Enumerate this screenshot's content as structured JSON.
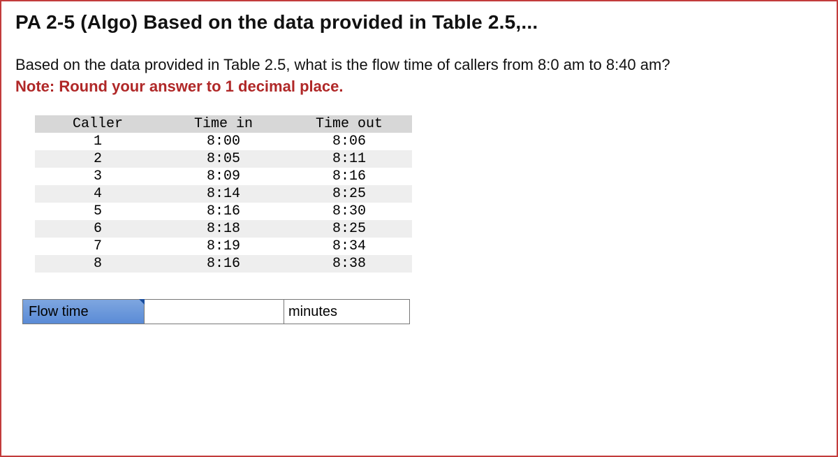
{
  "title": "PA 2-5 (Algo) Based on the data provided in Table 2.5,...",
  "question": "Based on the data provided in Table 2.5, what is the flow time of callers from 8:0 am to 8:40 am?",
  "note": "Note: Round your answer to 1 decimal place.",
  "table": {
    "headers": {
      "c1": "Caller",
      "c2": "Time in",
      "c3": "Time out"
    },
    "rows": [
      {
        "caller": "1",
        "time_in": "8:00",
        "time_out": "8:06"
      },
      {
        "caller": "2",
        "time_in": "8:05",
        "time_out": "8:11"
      },
      {
        "caller": "3",
        "time_in": "8:09",
        "time_out": "8:16"
      },
      {
        "caller": "4",
        "time_in": "8:14",
        "time_out": "8:25"
      },
      {
        "caller": "5",
        "time_in": "8:16",
        "time_out": "8:30"
      },
      {
        "caller": "6",
        "time_in": "8:18",
        "time_out": "8:25"
      },
      {
        "caller": "7",
        "time_in": "8:19",
        "time_out": "8:34"
      },
      {
        "caller": "8",
        "time_in": "8:16",
        "time_out": "8:38"
      }
    ]
  },
  "answer": {
    "label": "Flow time",
    "value": "",
    "unit": "minutes"
  }
}
